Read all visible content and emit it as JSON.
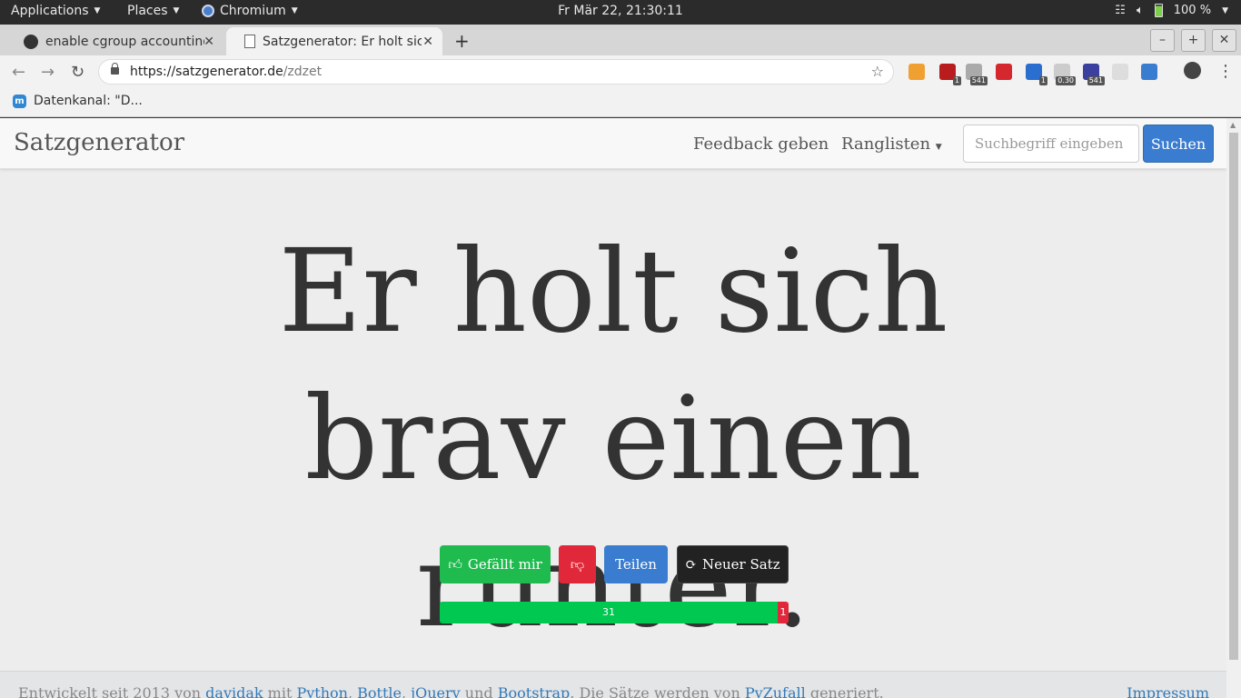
{
  "topbar": {
    "applications": "Applications",
    "places": "Places",
    "browser_app": "Chromium",
    "clock": "Fr Mär 22, 21:30:11",
    "battery": "100 %"
  },
  "tabs": [
    {
      "title": "enable cgroup accounting",
      "icon": "github-icon"
    },
    {
      "title": "Satzgenerator: Er holt sich brav einen runter.",
      "icon": "page-icon"
    }
  ],
  "address": {
    "host": "https://satzgenerator.de",
    "path": "/zdzet"
  },
  "extensions": [
    {
      "name": "ext-face-icon",
      "color": "#f0a030",
      "badge": ""
    },
    {
      "name": "ext-shield-icon",
      "color": "#b81c1c",
      "badge": "1"
    },
    {
      "name": "ext-stack-icon",
      "color": "#aaaaaa",
      "badge": "541"
    },
    {
      "name": "ext-pdf-icon",
      "color": "#d4282e",
      "badge": ""
    },
    {
      "name": "ext-s-icon",
      "color": "#2a6fd0",
      "badge": "1"
    },
    {
      "name": "ext-gauge-icon",
      "color": "#cccccc",
      "badge": "0.30"
    },
    {
      "name": "ext-blue-icon",
      "color": "#3b3f9e",
      "badge": "541"
    },
    {
      "name": "ext-bars-icon",
      "color": "#dddddd",
      "badge": ""
    },
    {
      "name": "ext-feather-icon",
      "color": "#3a7dd0",
      "badge": ""
    }
  ],
  "bookmarks": [
    {
      "label": "Datenkanal: \"D..."
    }
  ],
  "site": {
    "brand": "Satzgenerator",
    "nav_feedback": "Feedback geben",
    "nav_ranking": "Ranglisten",
    "search_placeholder": "Suchbegriff eingeben",
    "search_button": "Suchen"
  },
  "sentence": {
    "line1": "Er holt sich",
    "line2": "brav einen",
    "line3": "runter."
  },
  "actions": {
    "like": "Gefällt mir",
    "share": "Teilen",
    "new_sentence": "Neuer Satz"
  },
  "rating": {
    "up": "31",
    "down": "1"
  },
  "footer": {
    "text1": "Entwickelt seit 2013 von ",
    "author": "davidak",
    "text2": " mit ",
    "python": "Python",
    "comma1": ", ",
    "bottle": "Bottle",
    "comma2": ", ",
    "jquery": "jQuery",
    "text3": " und ",
    "bootstrap": "Bootstrap",
    "text4": ". Die Sätze werden von ",
    "pyzufall": "PyZufall",
    "text5": " generiert.",
    "impressum": "Impressum"
  }
}
